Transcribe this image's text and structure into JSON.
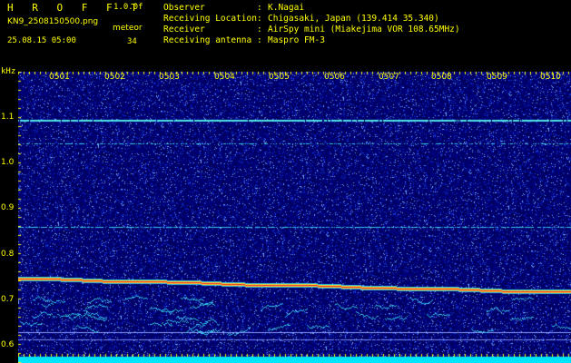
{
  "header": {
    "brand": "H R O F F T",
    "version": "1.0.0f",
    "filename": "KN9_2508150500.png",
    "meteor_label": "meteor",
    "meteor_count": "34",
    "datetime": "25.08.15 05:00",
    "info": [
      {
        "key": "Observer",
        "value": "K.Nagai"
      },
      {
        "key": "Receiving Location",
        "value": "Chigasaki, Japan (139.414 35.340)"
      },
      {
        "key": "Receiver",
        "value": "AirSpy mini (Miakejima VOR 108.65MHz)"
      },
      {
        "key": "Receiving antenna",
        "value": "Maspro FM-3"
      }
    ],
    "separator": ":"
  },
  "spectrogram": {
    "y_unit": "kHz",
    "y_ticks": [
      "1.1",
      "1.0",
      "0.9",
      "0.8",
      "0.7",
      "0.6"
    ],
    "x_ticks": [
      "0501",
      "0502",
      "0503",
      "0504",
      "0505",
      "0506",
      "0507",
      "0508",
      "0509",
      "0510"
    ],
    "colors": {
      "background": "#000a6e",
      "label": "#ffff00",
      "baseline": "#00e5ff"
    },
    "meteor_count": 34
  }
}
